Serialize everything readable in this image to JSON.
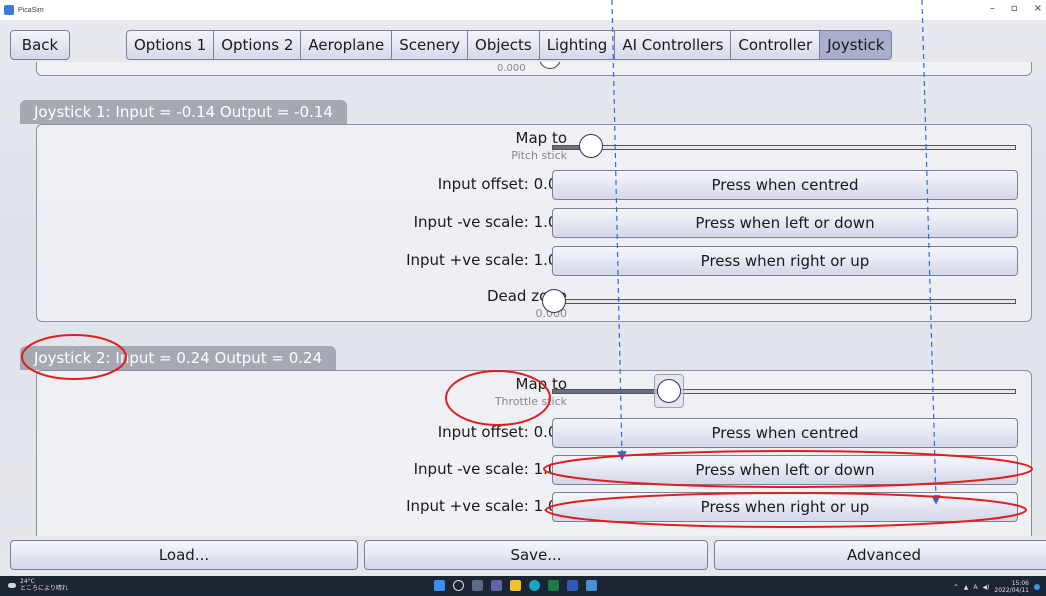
{
  "window": {
    "title": "PicaSim",
    "controls": [
      "–",
      "▫",
      "×"
    ]
  },
  "nav": {
    "back_label": "Back",
    "tabs": [
      "Options 1",
      "Options 2",
      "Aeroplane",
      "Scenery",
      "Objects",
      "Lighting",
      "AI Controllers",
      "Controller",
      "Joystick"
    ],
    "active_tab": "Joystick"
  },
  "prev_section": {
    "dead_zone_value": "0.000"
  },
  "joystick1": {
    "header": "Joystick 1: Input = -0.14 Output = -0.14",
    "map_to_label": "Map to",
    "map_to_value": "Pitch stick",
    "map_to_level": 0.08,
    "input_offset_label": "Input offset: 0.00",
    "input_offset_button": "Press when centred",
    "neg_scale_label": "Input -ve scale: 1.00",
    "neg_scale_button": "Press when left or down",
    "pos_scale_label": "Input +ve scale: 1.00",
    "pos_scale_button": "Press when right or up",
    "dead_zone_label": "Dead zone",
    "dead_zone_value": "0.000",
    "dead_zone_level": 0.0
  },
  "joystick2": {
    "header": "Joystick 2: Input = 0.24 Output = 0.24",
    "map_to_label": "Map to",
    "map_to_value": "Throttle stick",
    "map_to_level": 0.25,
    "input_offset_label": "Input offset: 0.00",
    "input_offset_button": "Press when centred",
    "neg_scale_label": "Input -ve scale: 1.00",
    "neg_scale_button": "Press when left or down",
    "pos_scale_label": "Input +ve scale: 1.00",
    "pos_scale_button": "Press when right or up"
  },
  "bottom": {
    "load_label": "Load...",
    "save_label": "Save...",
    "advanced_label": "Advanced"
  },
  "taskbar": {
    "weather_temp": "24°C",
    "weather_desc": "ところにより晴れ",
    "time": "15:06",
    "date": "2022/04/11"
  },
  "colors": {
    "annotation_red": "#e01e1e",
    "annotation_blue": "#2f6bd8",
    "active_tab": "#a9aecd"
  }
}
